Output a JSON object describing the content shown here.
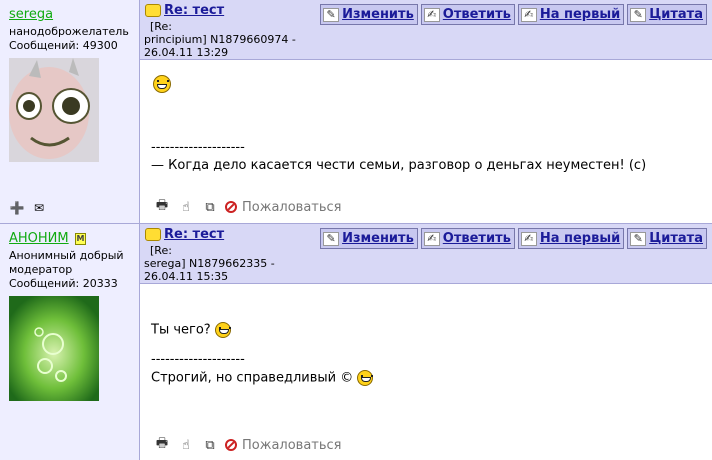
{
  "posts": [
    {
      "author": {
        "name": "serega",
        "rank": "нанодоброжелатель",
        "messages": "Сообщений: 49300"
      },
      "subject": "Re: тест",
      "ref_lines": [
        "[Re:",
        "principium]  N1879660974 -",
        "26.04.11 13:29"
      ],
      "body": {
        "divider": "--------------------",
        "signature": "— Когда дело касается чести семьи, разговор о деньгах неуместен! (с)"
      },
      "complain": "Пожаловаться"
    },
    {
      "author": {
        "name": "АНОНИМ",
        "moderator_badge": "M",
        "rank_line1": "Анонимный добрый",
        "rank_line2": "модератор",
        "messages": "Сообщений: 20333"
      },
      "subject": "Re: тест",
      "ref_lines": [
        "[Re:",
        "serega]  N1879662335 -",
        "26.04.11 15:35"
      ],
      "body": {
        "text": "Ты чего?",
        "divider": "--------------------",
        "signature": "Строгий, но справедливый ©"
      },
      "complain": "Пожаловаться"
    }
  ],
  "buttons": {
    "edit": "Изменить",
    "reply": "Ответить",
    "first": "На первый",
    "quote": "Цитата"
  },
  "colors": {
    "author_bg": "#eeeeff",
    "header_bg": "#d8d8f6",
    "link": "#1b1b99",
    "username": "#11aa11"
  }
}
